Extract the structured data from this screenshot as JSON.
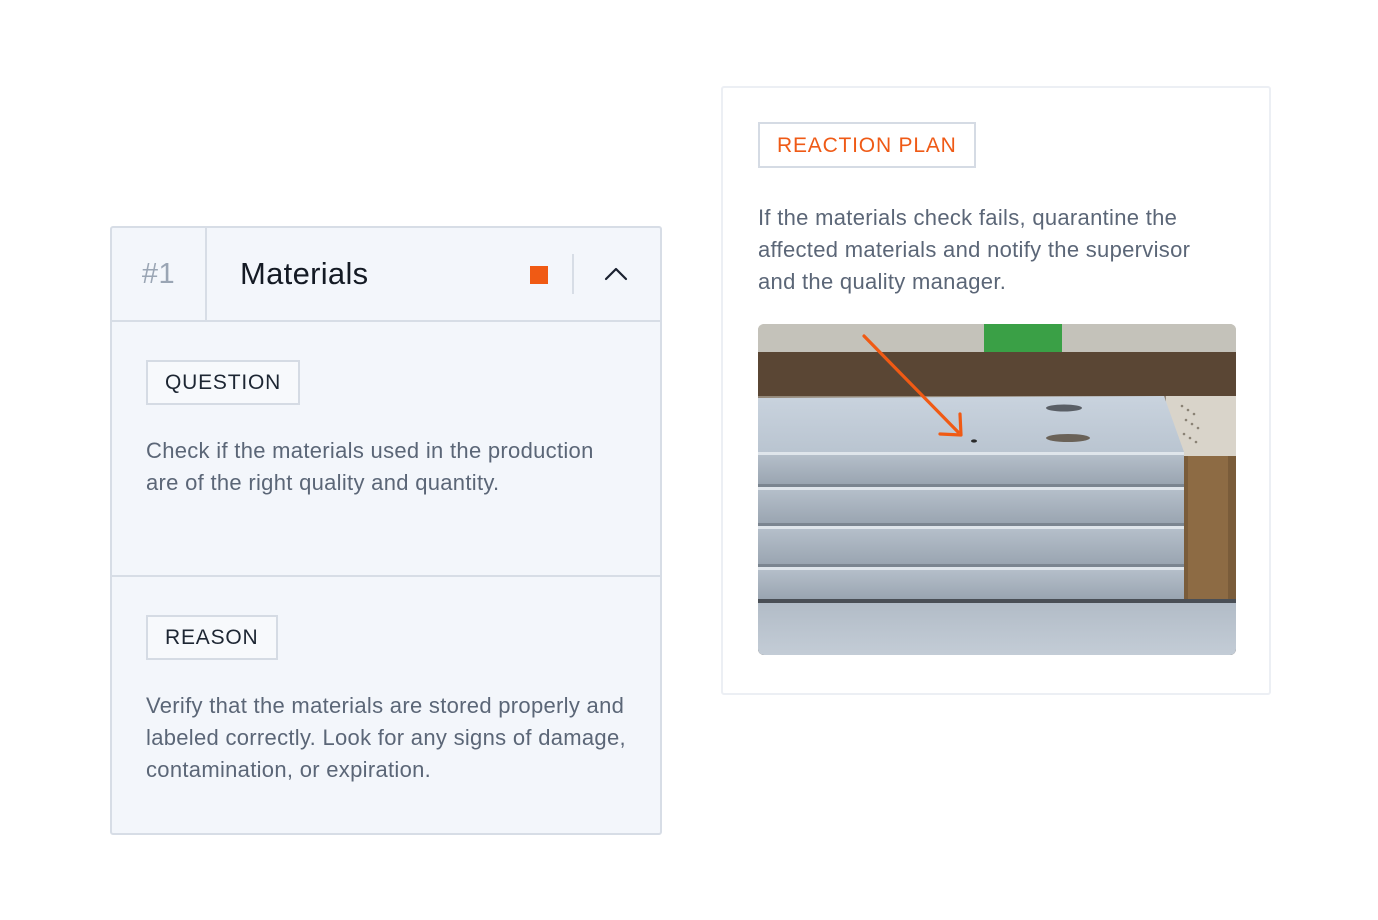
{
  "item": {
    "number": "#1",
    "title": "Materials",
    "status_color": "#f05a14",
    "collapse_icon": "chevron-up-icon"
  },
  "question": {
    "label": "QUESTION",
    "text": "Check if the materials used in the production are of the right quality and quantity."
  },
  "reason": {
    "label": "REASON",
    "text": "Verify that the materials are stored properly and labeled correctly. Look for any signs of damage, contamination, or expiration."
  },
  "reaction_plan": {
    "label": "REACTION PLAN",
    "text": "If the materials check fails, quarantine the affected materials and notify the supervisor and the quality manager.",
    "accent_color": "#ef5a16",
    "photo_icon": "stacked-panels-photo"
  }
}
